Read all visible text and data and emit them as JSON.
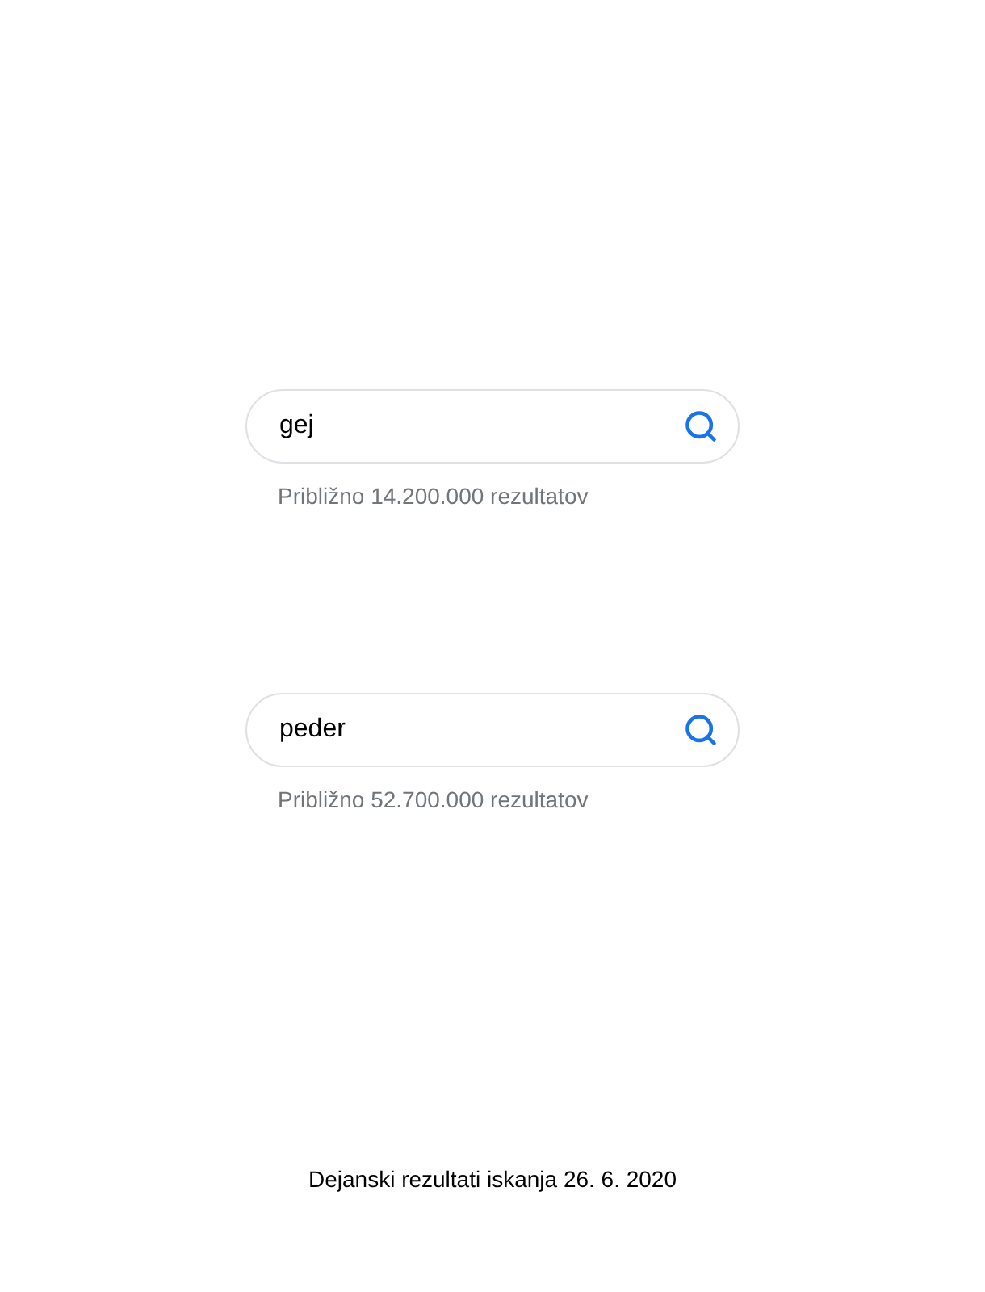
{
  "searches": [
    {
      "query": "gej",
      "results": "Približno 14.200.000 rezultatov"
    },
    {
      "query": "peder",
      "results": "Približno 52.700.000 rezultatov"
    }
  ],
  "caption": "Dejanski rezultati iskanja 26. 6. 2020"
}
